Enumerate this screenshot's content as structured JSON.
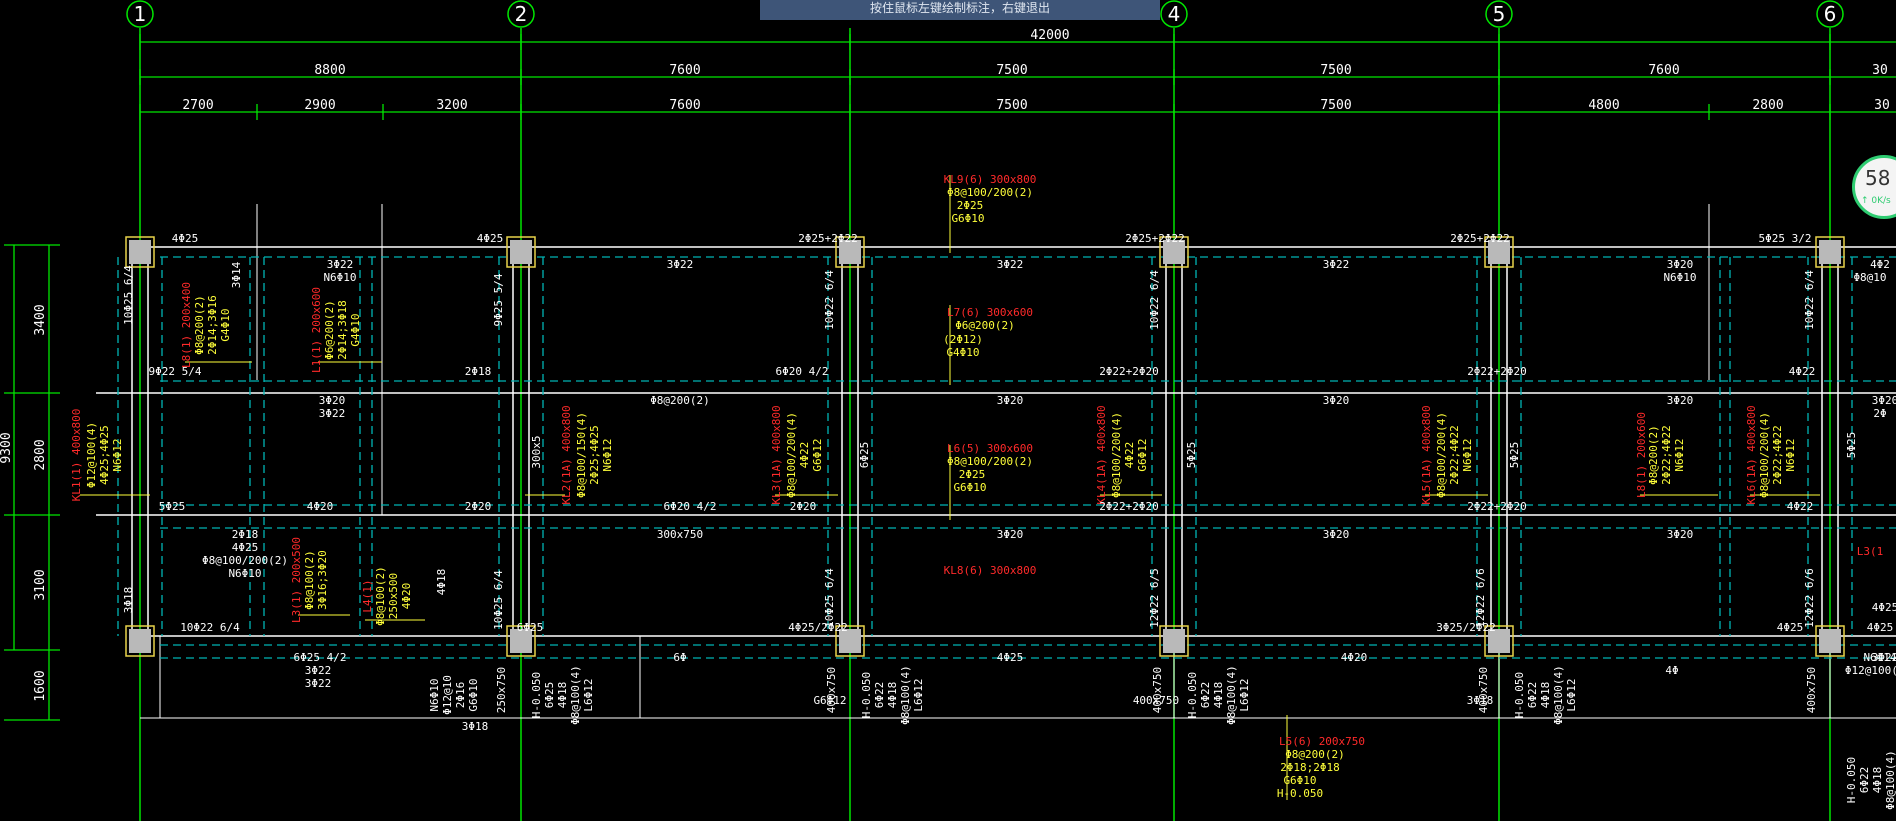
{
  "status_hint": "按住鼠标左键绘制标注，右键退出",
  "net_speed": {
    "percent": "58",
    "rate": "↑ 0K/s"
  },
  "grid_axes": [
    "1",
    "2",
    "",
    "4",
    "5",
    "6"
  ],
  "dims": {
    "total": "42000",
    "level1": [
      "8800",
      "7600",
      "7500",
      "7500",
      "7600",
      "30"
    ],
    "level2": [
      "2700",
      "2900",
      "3200",
      "7600",
      "7500",
      "7500",
      "4800",
      "2800",
      "30"
    ],
    "vertical": [
      "3400",
      "2800",
      "3100",
      "1600"
    ],
    "vertical_total": "9300"
  },
  "labels_red": [
    "KL9(6) 300x800",
    "L7(6) 300x600",
    "L6(5) 300x600",
    "KL8(6) 300x800",
    "L5(6) 200x750",
    "L8(1) 200x400",
    "L1(1) 200x600",
    "KL1(1) 400x800",
    "KL2(1A) 400x800",
    "KL3(1A) 400x800",
    "KL4(1A) 400x800",
    "KL5(1A) 400x800",
    "L8(1) 200x600",
    "KL6(1A) 400x800",
    "L3(1) 200x500",
    "L4(1)",
    "L3(1"
  ],
  "labels_yellow": [
    "Φ8@100/200(2)",
    "2Φ25",
    "G6Φ10",
    "Φ6@200(2)",
    "(2Φ12)",
    "G4Φ10",
    "Φ8@100/200(2)",
    "2Φ25",
    "G6Φ10",
    "Φ8@200(2)",
    "2Φ18;2Φ18",
    "G6Φ10",
    "H-0.050",
    "Φ12@100(4)",
    "4Φ25;4Φ25",
    "N6Φ12",
    "Φ8@100/150(4)",
    "2Φ25;4Φ25",
    "N6Φ12",
    "Φ8@100/200(4)",
    "4Φ22",
    "G6Φ12",
    "Φ8@100/200(4)",
    "4Φ22",
    "G6Φ12",
    "Φ8@100/200(4)",
    "2Φ22;4Φ22",
    "N6Φ12",
    "Φ8@100(2)",
    "3Φ16;3Φ20",
    "Φ8@100(2)",
    "250x500",
    "4Φ20",
    "Φ8@200(2)",
    "2Φ14;3Φ16",
    "G4Φ10",
    "Φ6@200(2)",
    "2Φ14;3Φ18",
    "G4Φ10",
    "Φ8@200(2)",
    "2Φ22;4Φ22",
    "N6Φ12",
    "Φ8@100/200(4)",
    "2Φ22;4Φ22",
    "N6Φ12"
  ],
  "labels_white": [
    "4Φ25",
    "4Φ25",
    "2Φ25+2Φ22",
    "2Φ25+2Φ22",
    "2Φ25+2Φ22",
    "5Φ25 3/2",
    "3Φ22",
    "N6Φ10",
    "3Φ22",
    "3Φ22",
    "3Φ22",
    "3Φ20",
    "N6Φ10",
    "4Φ2",
    "Φ8@10",
    "10Φ25 6/4",
    "3Φ14",
    "9Φ25 5/4",
    "10Φ22 6/4",
    "10Φ22 6/4",
    "10Φ22 6/4",
    "9Φ22 5/4",
    "2Φ18",
    "6Φ20 4/2",
    "2Φ22+2Φ20",
    "2Φ22+2Φ20",
    "4Φ22",
    "3Φ20",
    "3Φ22",
    "Φ8@200(2)",
    "3Φ20",
    "3Φ20",
    "3Φ20",
    "3Φ20",
    "2Φ",
    "300x5",
    "6Φ25",
    "5Φ25",
    "5Φ25",
    "5Φ25",
    "5Φ25",
    "4Φ20",
    "2Φ20",
    "6Φ20 4/2",
    "2Φ20",
    "2Φ22+2Φ20",
    "2Φ22+2Φ20",
    "4Φ22",
    "2Φ18",
    "4Φ25",
    "Φ8@100/200(2)",
    "N6Φ10",
    "300x750",
    "3Φ20",
    "3Φ20",
    "3Φ20",
    "4Φ18",
    "3Φ18",
    "10Φ25 6/4",
    "10Φ25 6/4",
    "12Φ22 6/5",
    "12Φ22 6/6",
    "12Φ22 6/6",
    "10Φ22 6/4",
    "6Φ25",
    "4Φ25/2Φ22",
    "3Φ25/2Φ22",
    "4Φ25",
    "4Φ25",
    "4Φ25",
    "6Φ25 4/2",
    "6Φ",
    "4Φ25",
    "4Φ20",
    "3Φ22",
    "3Φ22",
    "3Φ22",
    "4Φ",
    "Φ12@100(2)",
    "N6Φ14",
    "N6Φ10",
    "Φ12@10",
    "2Φ16",
    "G6Φ10",
    "250x750",
    "H-0.050",
    "6Φ25",
    "4Φ18",
    "Φ8@100(4)",
    "L6Φ12",
    "400x750",
    "H-0.050",
    "6Φ22",
    "4Φ18",
    "Φ8@100(4)",
    "L6Φ12",
    "400x750",
    "H-0.050",
    "6Φ22",
    "4Φ18",
    "Φ8@100(4)",
    "L6Φ12",
    "400x750",
    "H-0.050",
    "6Φ22",
    "4Φ18",
    "Φ8@100(4)",
    "L6Φ12",
    "400x750",
    "H-0.050",
    "6Φ22",
    "4Φ18",
    "Φ8@100(4)",
    "G6Φ12",
    "400x750",
    "3Φ18",
    "3Φ18",
    "3Φ18",
    "Φ8@100(2)"
  ],
  "colors": {
    "axis": "#00e600",
    "dim": "#00e600",
    "wall": "#ffffff",
    "beam_dash": "#00b4b4",
    "column": "#b9b9b9",
    "column_edge": "#e8d34a",
    "red_text": "#ff2a2a",
    "yellow_text": "#ffff3a",
    "white_text": "#ffffff"
  }
}
